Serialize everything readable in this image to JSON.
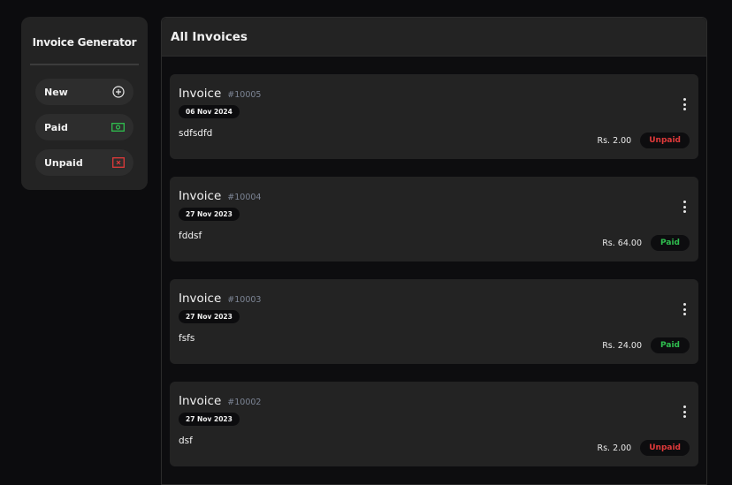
{
  "sidebar": {
    "title": "Invoice Generator",
    "items": [
      {
        "label": "New",
        "icon": "plus-circle-icon"
      },
      {
        "label": "Paid",
        "icon": "money-icon"
      },
      {
        "label": "Unpaid",
        "icon": "x-box-icon"
      }
    ]
  },
  "main": {
    "title": "All Invoices",
    "invoices": [
      {
        "label": "Invoice",
        "number": "#10005",
        "date": "06 Nov 2024",
        "client": "sdfsdfd",
        "amount": "Rs. 2.00",
        "status": "Unpaid"
      },
      {
        "label": "Invoice",
        "number": "#10004",
        "date": "27 Nov 2023",
        "client": "fddsf",
        "amount": "Rs. 64.00",
        "status": "Paid"
      },
      {
        "label": "Invoice",
        "number": "#10003",
        "date": "27 Nov 2023",
        "client": "fsfs",
        "amount": "Rs. 24.00",
        "status": "Paid"
      },
      {
        "label": "Invoice",
        "number": "#10002",
        "date": "27 Nov 2023",
        "client": "dsf",
        "amount": "Rs. 2.00",
        "status": "Unpaid"
      }
    ]
  },
  "colors": {
    "paid": "#2fbf4f",
    "unpaid": "#e03a3a"
  }
}
